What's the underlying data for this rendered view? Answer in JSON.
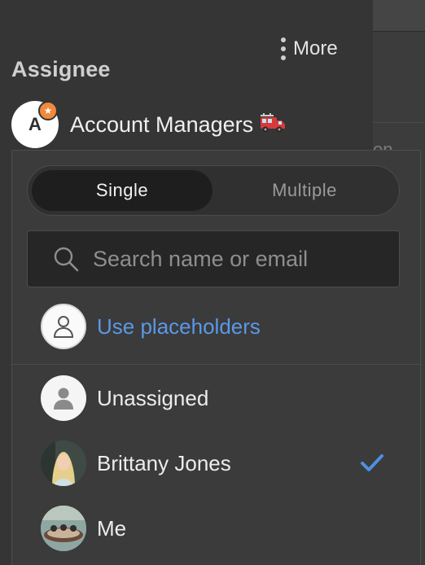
{
  "header": {
    "more_label": "More",
    "assignee_label": "Assignee"
  },
  "current_assignee": {
    "initial": "A",
    "name": "Account Managers",
    "badge_icon": "star-icon",
    "emoji_icon": "fire-truck-icon"
  },
  "dropdown": {
    "mode_toggle": {
      "single_label": "Single",
      "multiple_label": "Multiple",
      "selected": "Single"
    },
    "search": {
      "placeholder": "Search name or email",
      "value": ""
    },
    "placeholders_label": "Use placeholders",
    "options": [
      {
        "label": "Unassigned",
        "avatar": "person-silhouette-icon",
        "selected": false
      },
      {
        "label": "Brittany Jones",
        "avatar": "user-photo",
        "selected": true
      },
      {
        "label": "Me",
        "avatar": "user-photo",
        "selected": false
      }
    ]
  },
  "colors": {
    "accent_link": "#5b98e8",
    "check": "#4f8fe0",
    "badge": "#f08a3c"
  }
}
